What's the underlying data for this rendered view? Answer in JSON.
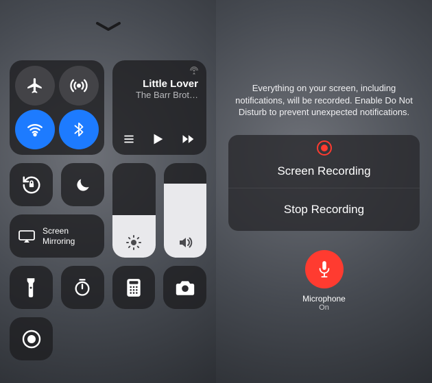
{
  "control_center": {
    "music": {
      "title": "Little Lover",
      "artist": "The Barr Brot…"
    },
    "screen_mirroring_label": "Screen\nMirroring",
    "brightness_level": 0.45,
    "volume_level": 0.78,
    "connectivity": {
      "airplane": false,
      "cellular": true,
      "wifi": true,
      "bluetooth": true
    }
  },
  "screen_recording": {
    "notice": "Everything on your screen, including notifications, will be recorded. Enable Do Not Disturb to prevent unexpected notifications.",
    "primary_label": "Screen Recording",
    "stop_label": "Stop Recording",
    "mic_label": "Microphone",
    "mic_state": "On"
  }
}
